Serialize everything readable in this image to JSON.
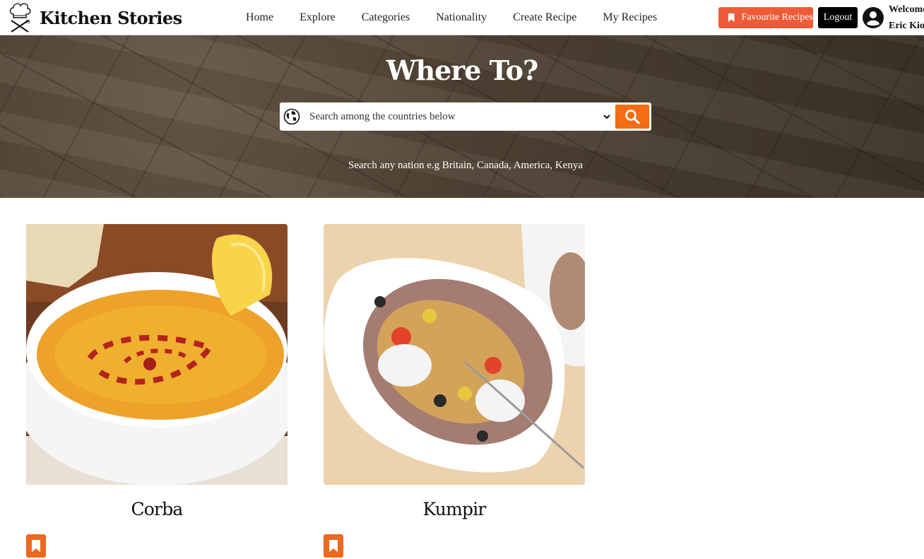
{
  "brand": {
    "name": "Kitchen Stories"
  },
  "nav": {
    "links": [
      "Home",
      "Explore",
      "Categories",
      "Nationality",
      "Create Recipe",
      "My Recipes"
    ],
    "favourite_label": "Favourite Recipes",
    "logout_label": "Logout",
    "welcome_line1": "Welcome",
    "welcome_line2": "Eric Kiok"
  },
  "hero": {
    "title": "Where To?",
    "search_placeholder": "Search among the countries below",
    "hint": "Search any nation e.g Britain, Canada, America, Kenya"
  },
  "recipes": [
    {
      "title": "Corba"
    },
    {
      "title": "Kumpir"
    }
  ],
  "colors": {
    "accent_orange": "#f26d14",
    "favourite_red": "#ef5b37",
    "logout_black": "#000000"
  }
}
